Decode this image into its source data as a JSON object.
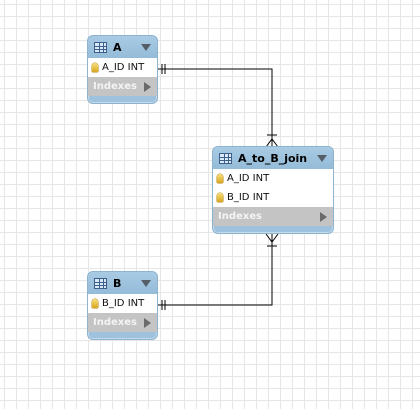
{
  "entities": [
    {
      "title": "A",
      "columns": [
        {
          "text": "A_ID INT",
          "icon": "key-icon"
        }
      ],
      "indexes_label": "Indexes"
    },
    {
      "title": "A_to_B_join",
      "columns": [
        {
          "text": "A_ID INT",
          "icon": "key-icon"
        },
        {
          "text": "B_ID INT",
          "icon": "key-icon"
        }
      ],
      "indexes_label": "Indexes"
    },
    {
      "title": "B",
      "columns": [
        {
          "text": "B_ID INT",
          "icon": "key-icon"
        }
      ],
      "indexes_label": "Indexes"
    }
  ],
  "relationships": [
    {
      "from": "A",
      "to": "A_to_B_join",
      "from_cardinality": "one",
      "to_cardinality": "many"
    },
    {
      "from": "B",
      "to": "A_to_B_join",
      "from_cardinality": "one",
      "to_cardinality": "many"
    }
  ],
  "colors": {
    "header": "#9ec2de",
    "indexes": "#c4c4c4",
    "key": "#e8c84a",
    "line": "#000000",
    "grid": "#e6e6e6"
  }
}
